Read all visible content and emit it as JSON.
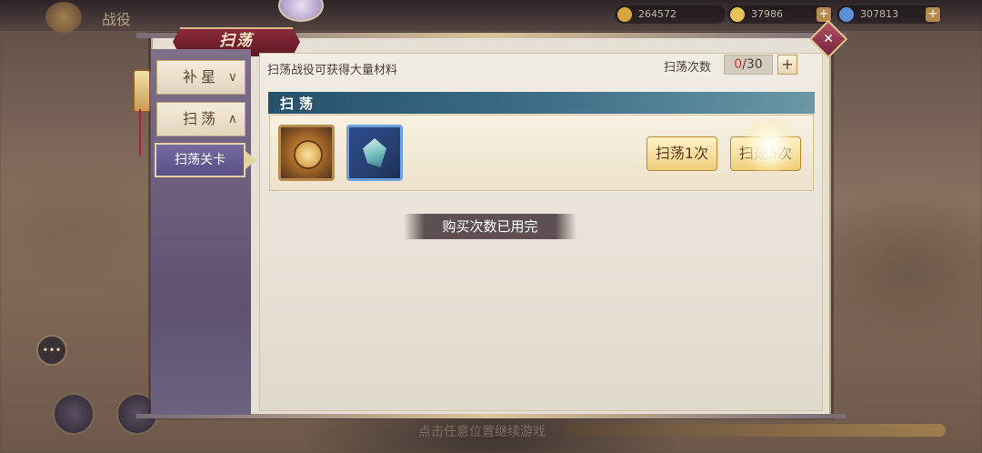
{
  "background": {
    "title": "战役",
    "resources": [
      {
        "value": "264572",
        "icon": "gold-coin-icon"
      },
      {
        "value": "37986",
        "icon": "ingot-icon"
      },
      {
        "value": "307813",
        "icon": "blue-gem-icon"
      }
    ],
    "bottom_hint": "点击任意位置继续游戏"
  },
  "dialog": {
    "title": "扫荡",
    "close_icon": "close-icon"
  },
  "nav": {
    "items": [
      {
        "label": "补星",
        "arrow": "∨"
      },
      {
        "label": "扫荡",
        "arrow": "∧"
      }
    ],
    "active_sub": "扫荡关卡"
  },
  "content": {
    "description": "扫荡战役可获得大量材料",
    "sweep_count_label": "扫荡次数",
    "sweep_count_used": "0",
    "sweep_count_total": "/30",
    "plus_label": "+",
    "section_title": "扫荡",
    "items": [
      {
        "icon": "bagua-plate-icon"
      },
      {
        "icon": "crystal-shard-icon"
      }
    ],
    "sweep_once_label": "扫荡1次",
    "sweep_many_label": "扫荡5次"
  },
  "toast": "购买次数已用完",
  "colors": {
    "accent_red": "#c2362e",
    "section_blue": "#27506a",
    "button_gold": "#f0cf7a"
  }
}
